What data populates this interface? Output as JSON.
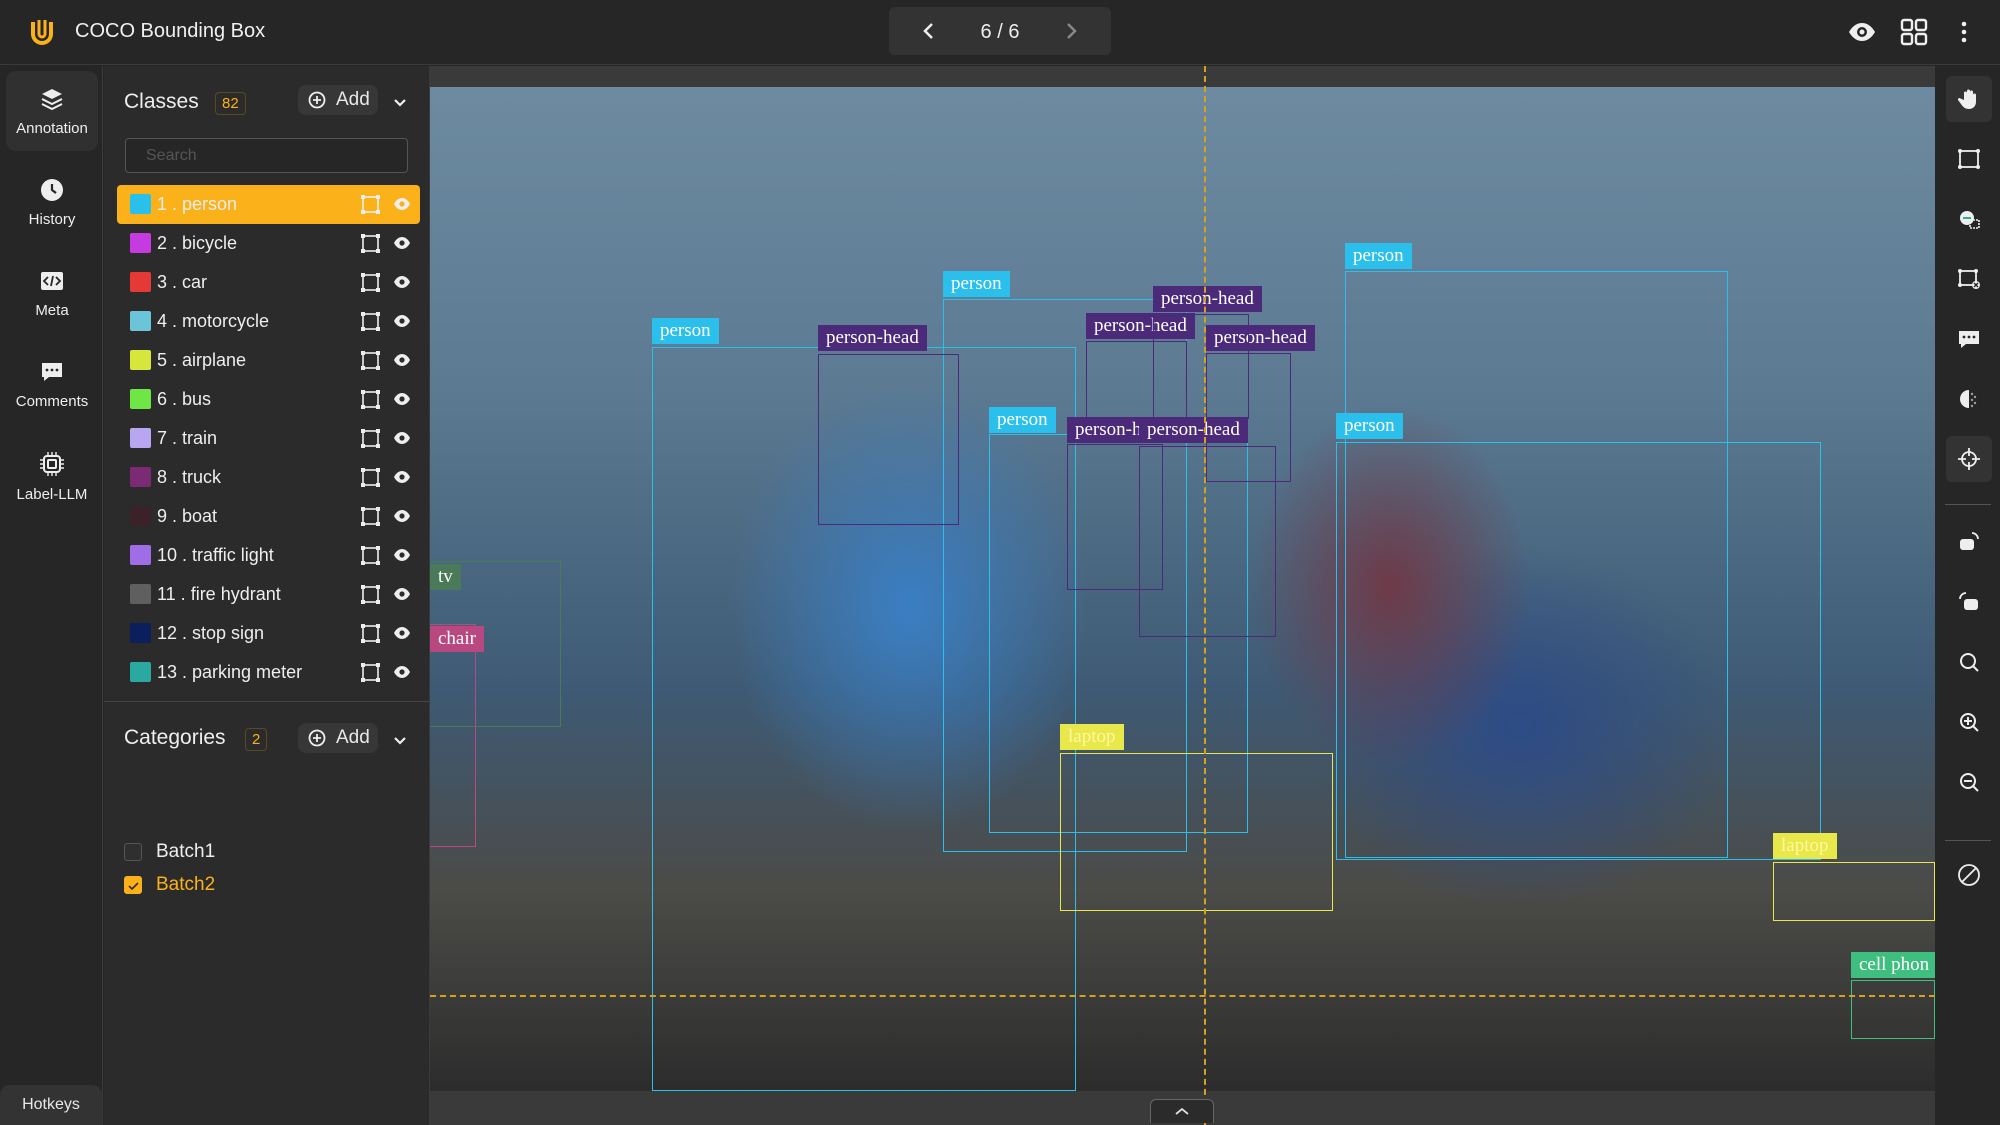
{
  "header": {
    "title": "COCO Bounding Box",
    "pager": "6 / 6",
    "accent": "#fbb11a"
  },
  "nav": {
    "items": [
      {
        "label": "Annotation",
        "icon": "layers-icon"
      },
      {
        "label": "History",
        "icon": "clock-icon"
      },
      {
        "label": "Meta",
        "icon": "code-icon"
      },
      {
        "label": "Comments",
        "icon": "comment-icon"
      },
      {
        "label": "Label-LLM",
        "icon": "chip-icon"
      }
    ],
    "hotkeys": "Hotkeys"
  },
  "classes": {
    "title": "Classes",
    "count": "82",
    "add": "Add",
    "search_placeholder": "Search",
    "items": [
      {
        "label": "1 . person",
        "color": "#2bc0ec"
      },
      {
        "label": "2 . bicycle",
        "color": "#c63be0"
      },
      {
        "label": "3 . car",
        "color": "#e53935"
      },
      {
        "label": "4 . motorcycle",
        "color": "#6cc4d8"
      },
      {
        "label": "5 . airplane",
        "color": "#d7e63a"
      },
      {
        "label": "6 . bus",
        "color": "#6ee646"
      },
      {
        "label": "7 . train",
        "color": "#b9a6f0"
      },
      {
        "label": "8 . truck",
        "color": "#7b2a74"
      },
      {
        "label": "9 . boat",
        "color": "#3a2228"
      },
      {
        "label": "10 . traffic light",
        "color": "#9f6ee6"
      },
      {
        "label": "11 . fire hydrant",
        "color": "#5f5f5f"
      },
      {
        "label": "12 . stop sign",
        "color": "#0a1f5c"
      },
      {
        "label": "13 . parking meter",
        "color": "#2aa9a0"
      }
    ]
  },
  "categories": {
    "title": "Categories",
    "count": "2",
    "add": "Add",
    "items": [
      {
        "label": "Batch1",
        "checked": false
      },
      {
        "label": "Batch2",
        "checked": true
      }
    ]
  },
  "annotations": [
    {
      "label": "person",
      "color": "#2bc0ec"
    },
    {
      "label": "person",
      "color": "#2bc0ec"
    },
    {
      "label": "person",
      "color": "#2bc0ec"
    },
    {
      "label": "person",
      "color": "#2bc0ec"
    },
    {
      "label": "person",
      "color": "#2bc0ec"
    },
    {
      "label": "person-head",
      "color": "#4b2a7a"
    },
    {
      "label": "person-head",
      "color": "#4b2a7a"
    },
    {
      "label": "person-head",
      "color": "#4b2a7a"
    },
    {
      "label": "person-head",
      "color": "#4b2a7a"
    },
    {
      "label": "person-head",
      "color": "#4b2a7a"
    },
    {
      "label": "person-head",
      "color": "#4b2a7a"
    },
    {
      "label": "laptop",
      "color": "#e8e84a"
    },
    {
      "label": "laptop",
      "color": "#e8e84a"
    },
    {
      "label": "cell phon",
      "color": "#3fbf7f"
    },
    {
      "label": "tv",
      "color": "#4a7a5a"
    },
    {
      "label": "chair",
      "color": "#b8487f"
    }
  ],
  "toolbar": {
    "tools": [
      "hand-icon",
      "rectangle-icon",
      "auto-annotate-icon",
      "remove-box-icon",
      "comment-icon",
      "contrast-icon",
      "crosshair-icon",
      "rotate-right-icon",
      "rotate-left-icon",
      "zoom-fit-icon",
      "zoom-in-icon",
      "zoom-out-icon",
      "hide-icon"
    ],
    "active": [
      "hand-icon",
      "crosshair-icon"
    ]
  }
}
